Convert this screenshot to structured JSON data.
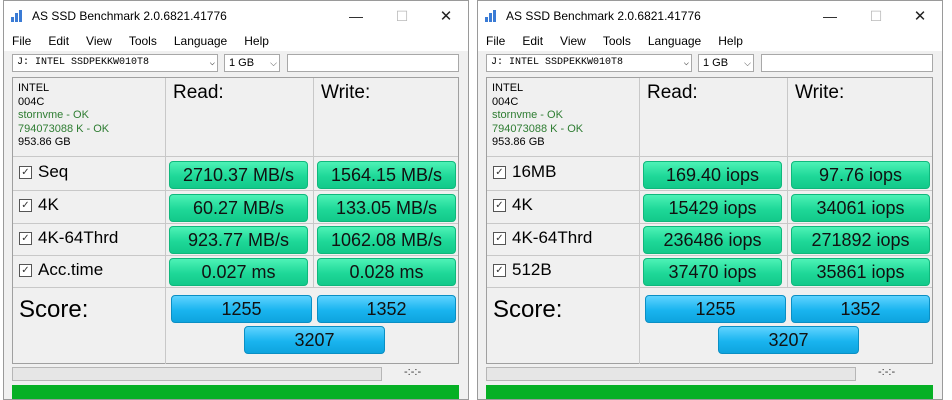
{
  "windows": [
    {
      "title": "AS SSD Benchmark 2.0.6821.41776",
      "menu": [
        "File",
        "Edit",
        "View",
        "Tools",
        "Language",
        "Help"
      ],
      "drive": "J: INTEL SSDPEKKW010T8",
      "size": "1 GB",
      "info": [
        "INTEL",
        "004C",
        "stornvme - OK",
        "794073088 K - OK",
        "953.86 GB"
      ],
      "read_header": "Read:",
      "write_header": "Write:",
      "rows": [
        {
          "label": "Seq",
          "read": "2710.37 MB/s",
          "write": "1564.15 MB/s",
          "checked": true
        },
        {
          "label": "4K",
          "read": "60.27 MB/s",
          "write": "133.05 MB/s",
          "checked": true
        },
        {
          "label": "4K-64Thrd",
          "read": "923.77 MB/s",
          "write": "1062.08 MB/s",
          "checked": true
        },
        {
          "label": "Acc.time",
          "read": "0.027 ms",
          "write": "0.028 ms",
          "checked": true
        }
      ],
      "score_label": "Score:",
      "score_read": "1255",
      "score_write": "1352",
      "score_total": "3207",
      "elapsed": "-:-:-"
    },
    {
      "title": "AS SSD Benchmark 2.0.6821.41776",
      "menu": [
        "File",
        "Edit",
        "View",
        "Tools",
        "Language",
        "Help"
      ],
      "drive": "J: INTEL SSDPEKKW010T8",
      "size": "1 GB",
      "info": [
        "INTEL",
        "004C",
        "stornvme - OK",
        "794073088 K - OK",
        "953.86 GB"
      ],
      "read_header": "Read:",
      "write_header": "Write:",
      "rows": [
        {
          "label": "16MB",
          "read": "169.40 iops",
          "write": "97.76 iops",
          "checked": true
        },
        {
          "label": "4K",
          "read": "15429 iops",
          "write": "34061 iops",
          "checked": true
        },
        {
          "label": "4K-64Thrd",
          "read": "236486 iops",
          "write": "271892 iops",
          "checked": true
        },
        {
          "label": "512B",
          "read": "37470 iops",
          "write": "35861 iops",
          "checked": true
        }
      ],
      "score_label": "Score:",
      "score_read": "1255",
      "score_write": "1352",
      "score_total": "3207",
      "elapsed": "-:-:-"
    }
  ],
  "colors": {
    "result_box": "#1ed898",
    "score_box": "#19b4ef",
    "status_bar": "#06b025"
  },
  "icons": {
    "app": "bar-chart-icon",
    "minimize": "minimize-icon",
    "maximize": "maximize-icon",
    "close": "close-icon",
    "checkbox": "checkbox-checked-icon"
  }
}
